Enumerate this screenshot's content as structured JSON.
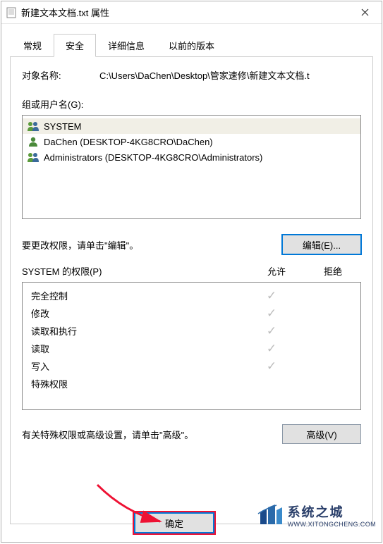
{
  "title": "新建文本文档.txt 属性",
  "tabs": {
    "general": "常规",
    "security": "安全",
    "details": "详细信息",
    "previous": "以前的版本"
  },
  "object": {
    "label": "对象名称:",
    "value": "C:\\Users\\DaChen\\Desktop\\管家速修\\新建文本文档.t"
  },
  "groups_label": "组或用户名(G):",
  "users": {
    "u0": "SYSTEM",
    "u1": "DaChen (DESKTOP-4KG8CRO\\DaChen)",
    "u2": "Administrators (DESKTOP-4KG8CRO\\Administrators)"
  },
  "edit_hint": "要更改权限，请单击\"编辑\"。",
  "buttons": {
    "edit": "编辑(E)...",
    "advanced": "高级(V)",
    "ok": "确定"
  },
  "perm_header": {
    "title": "SYSTEM 的权限(P)",
    "allow": "允许",
    "deny": "拒绝"
  },
  "perms": {
    "p0": {
      "name": "完全控制",
      "allow": true,
      "deny": false
    },
    "p1": {
      "name": "修改",
      "allow": true,
      "deny": false
    },
    "p2": {
      "name": "读取和执行",
      "allow": true,
      "deny": false
    },
    "p3": {
      "name": "读取",
      "allow": true,
      "deny": false
    },
    "p4": {
      "name": "写入",
      "allow": true,
      "deny": false
    },
    "p5": {
      "name": "特殊权限",
      "allow": false,
      "deny": false
    }
  },
  "adv_hint": "有关特殊权限或高级设置，请单击\"高级\"。",
  "watermark": {
    "brand": "系统之城",
    "url": "WWW.XITONGCHENG.COM"
  },
  "check": "✓"
}
